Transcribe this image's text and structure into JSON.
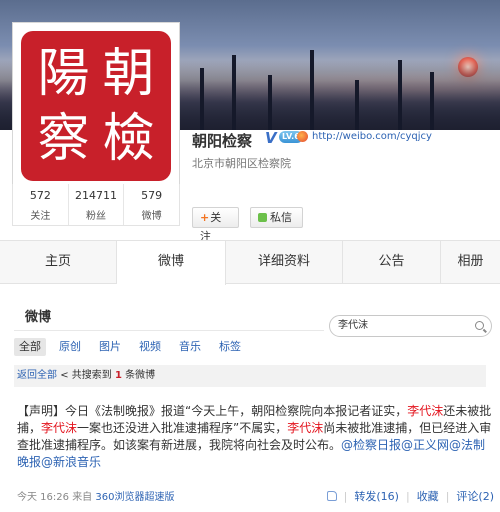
{
  "profile": {
    "name": "朝阳检察",
    "verified": "V",
    "level": "LV.6",
    "url": "http://weibo.com/cyqjcy",
    "location": "北京市朝阳区检察院",
    "seal_chars": [
      "朝",
      "陽",
      "檢",
      "察"
    ],
    "seal_color": "#c8202a"
  },
  "counts": [
    {
      "value": "572",
      "label": "关注"
    },
    {
      "value": "214711",
      "label": "粉丝"
    },
    {
      "value": "579",
      "label": "微博"
    }
  ],
  "buttons": {
    "follow_icon": "+",
    "follow": "关注",
    "message": "私信"
  },
  "tabs": [
    "主页",
    "微博",
    "详细资料",
    "公告",
    "相册"
  ],
  "active_tab": "微博",
  "feed": {
    "title": "微博",
    "search_value": "李代沫",
    "filters": [
      "全部",
      "原创",
      "图片",
      "视频",
      "音乐",
      "标签"
    ],
    "back_link": "返回全部",
    "result_prefix": "共搜索到",
    "result_count": "1",
    "result_suffix": "条微博"
  },
  "post": {
    "p1": "【声明】今日《法制晚报》报道“今天上午，朝阳检察院向本报记者证实，",
    "k1": "李代沫",
    "p2": "还未被批捕，",
    "k2": "李代沫",
    "p3": "一案也还没进入批准逮捕程序”不属实，",
    "k3": "李代沫",
    "p4": "尚未被批准逮捕，但已经进入审查批准逮捕程序。如该案有新进展，我院将向社会及时公布。",
    "tag1": "@检察日报",
    "tag2": "@正义网",
    "tag3": "@法制晚报",
    "tag4": "@新浪音乐",
    "time": "今天 16:26",
    "source_prefix": "来自",
    "source": "360浏览器超速版",
    "forward": "转发(16)",
    "favorite": "收藏",
    "comment": "评论(2)",
    "sep": "|"
  },
  "colors": {
    "link": "#2d63b3",
    "keyword": "#e3131d",
    "accent_red": "#c8202a"
  }
}
